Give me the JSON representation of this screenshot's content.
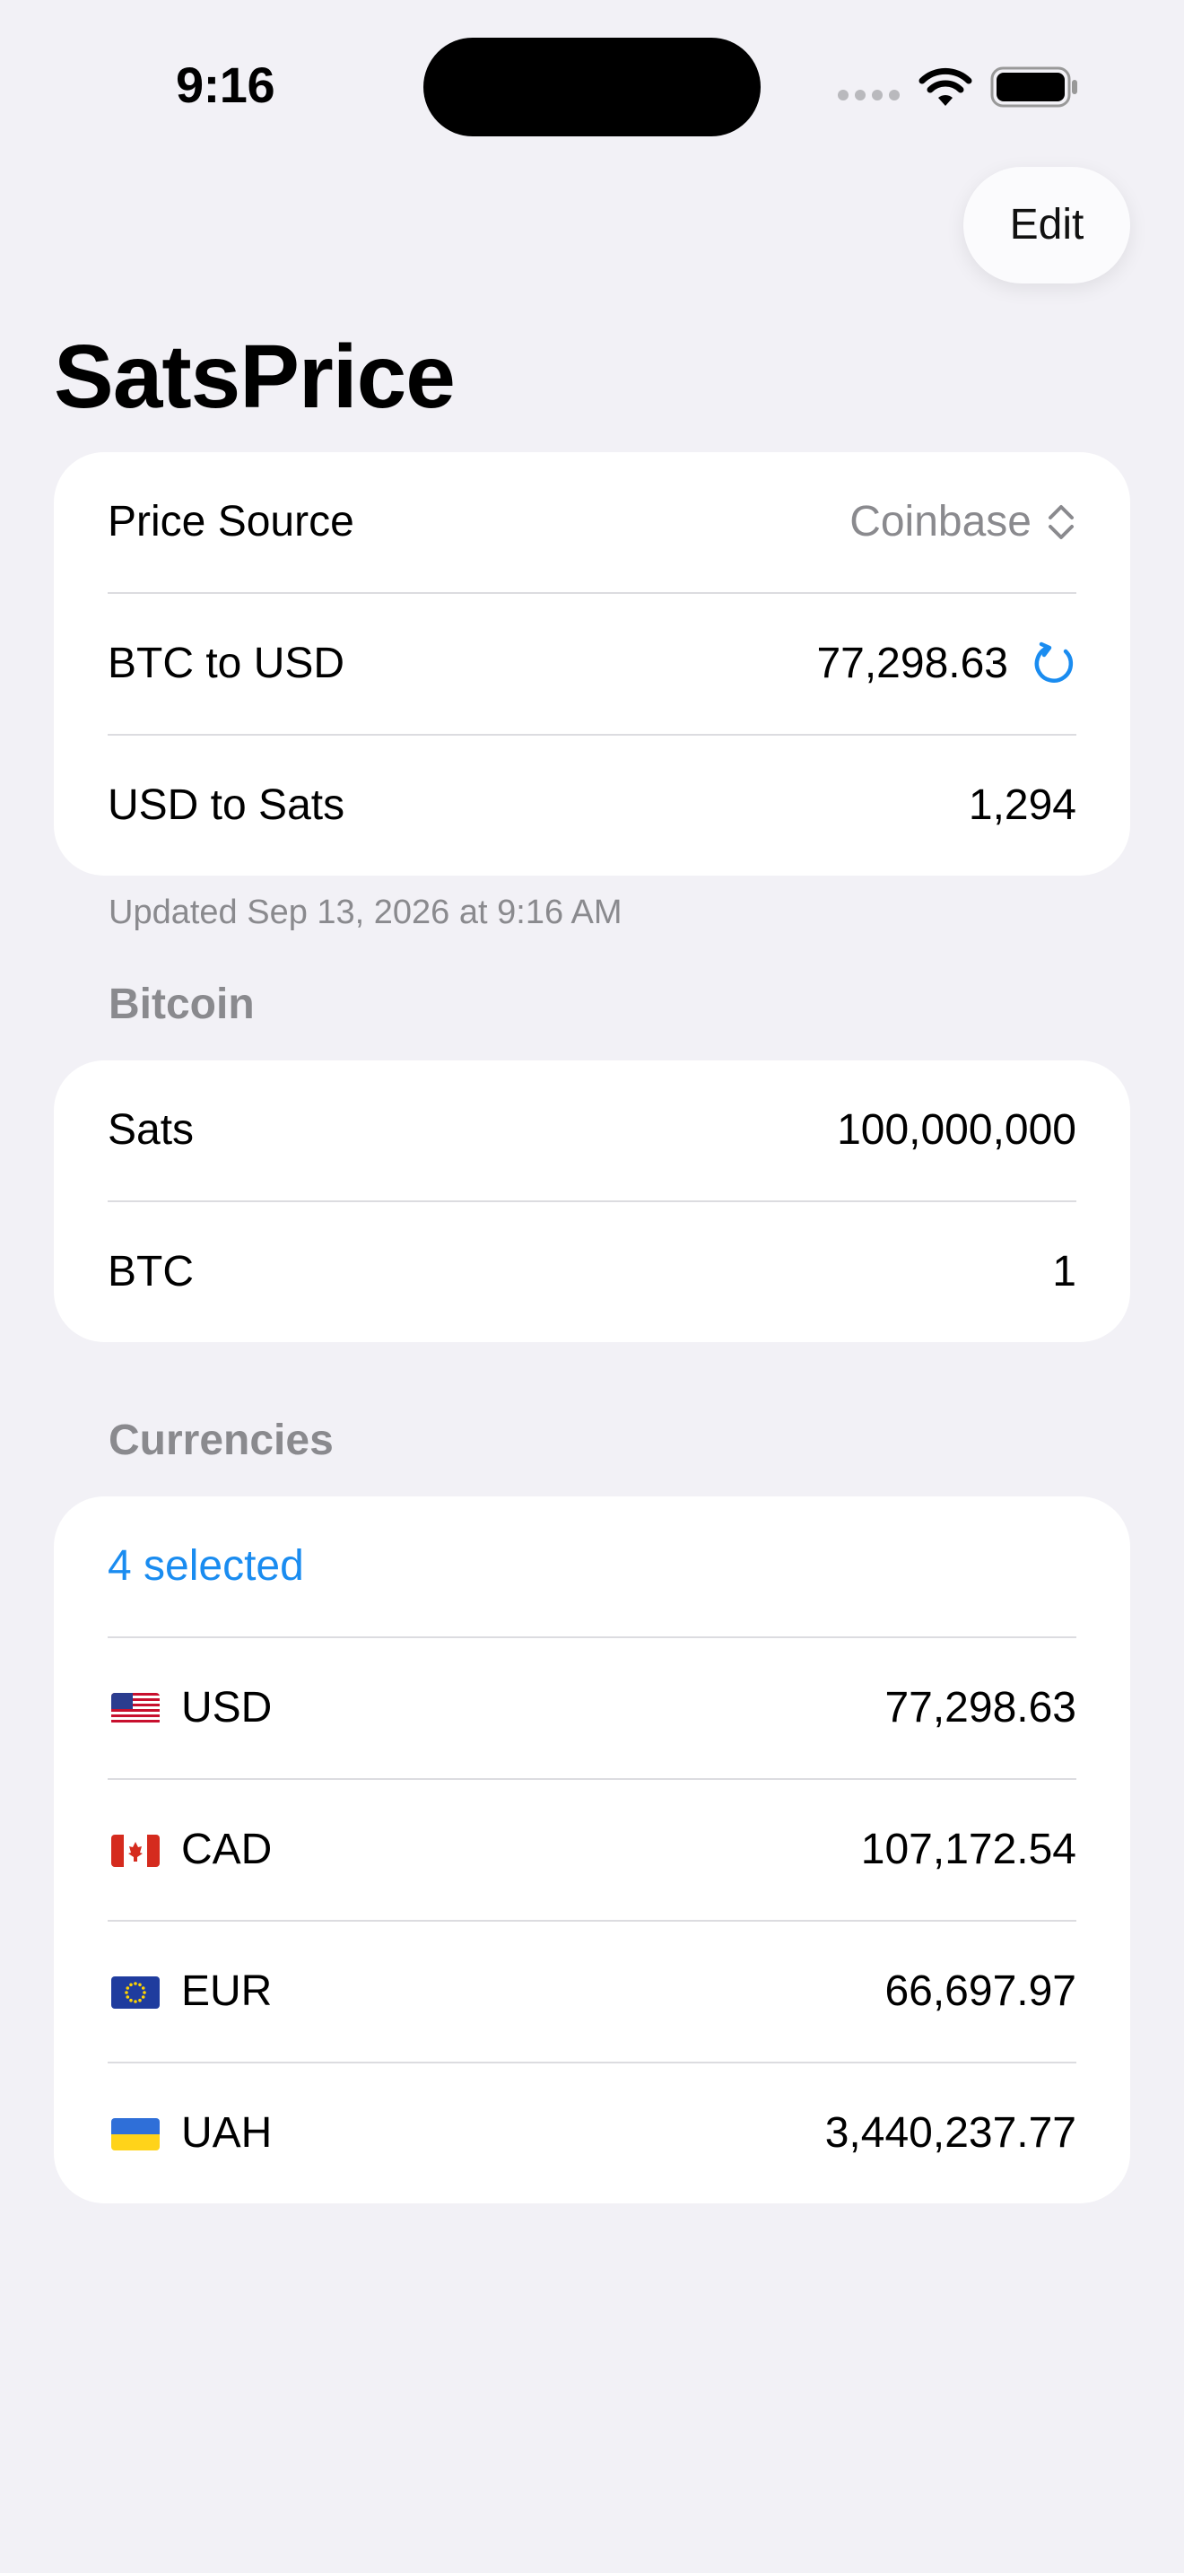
{
  "status_bar": {
    "time": "9:16",
    "icons": [
      "signal-icon",
      "wifi-icon",
      "battery-icon"
    ]
  },
  "toolbar": {
    "edit_label": "Edit"
  },
  "page_title": "SatsPrice",
  "price_card": {
    "price_source": {
      "label": "Price Source",
      "value": "Coinbase",
      "icon": "chevron-updown-icon"
    },
    "btc_to_usd": {
      "label": "BTC to USD",
      "value": "77,298.63",
      "icon": "refresh-icon"
    },
    "usd_to_sats": {
      "label": "USD to Sats",
      "value": "1,294"
    }
  },
  "updated_text": "Updated Sep 13, 2026 at 9:16 AM",
  "bitcoin_section": {
    "header": "Bitcoin",
    "rows": [
      {
        "label": "Sats",
        "value": "100,000,000"
      },
      {
        "label": "BTC",
        "value": "1"
      }
    ]
  },
  "currencies_section": {
    "header": "Currencies",
    "selected_label": "4 selected",
    "rows": [
      {
        "code": "USD",
        "value": "77,298.63",
        "flag": "us-flag-icon"
      },
      {
        "code": "CAD",
        "value": "107,172.54",
        "flag": "ca-flag-icon"
      },
      {
        "code": "EUR",
        "value": "66,697.97",
        "flag": "eu-flag-icon"
      },
      {
        "code": "UAH",
        "value": "3,440,237.77",
        "flag": "ua-flag-icon"
      }
    ]
  },
  "colors": {
    "background": "#f2f1f6",
    "card": "#ffffff",
    "accent": "#1a8cf0",
    "secondary_text": "#8a8a8e"
  }
}
